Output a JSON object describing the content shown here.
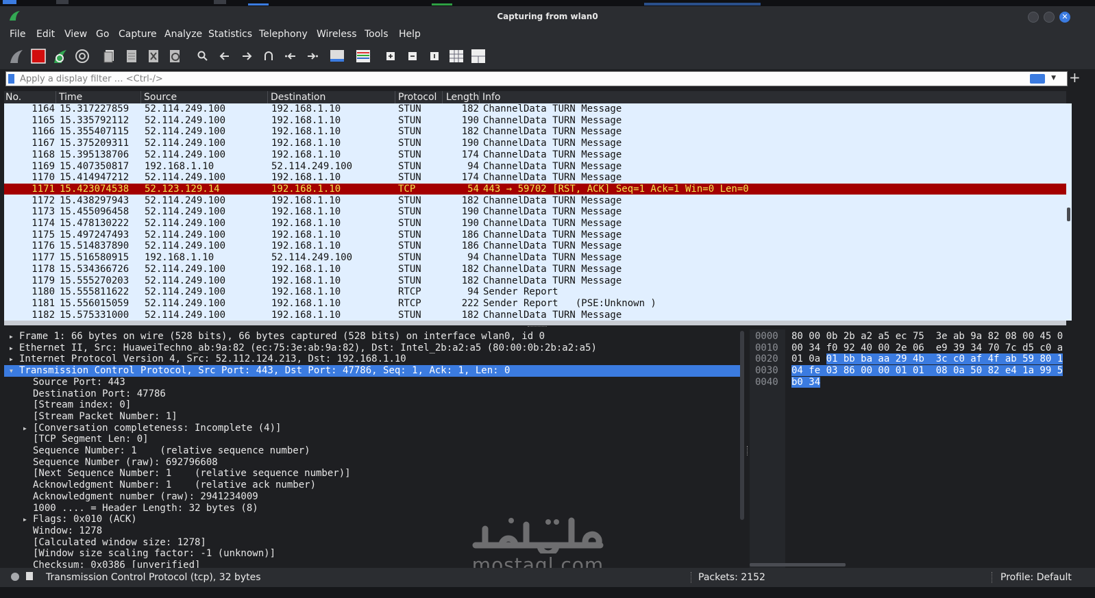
{
  "window": {
    "title": "Capturing from wlan0"
  },
  "menu": [
    "File",
    "Edit",
    "View",
    "Go",
    "Capture",
    "Analyze",
    "Statistics",
    "Telephony",
    "Wireless",
    "Tools",
    "Help"
  ],
  "filter": {
    "placeholder": "Apply a display filter … <Ctrl-/>"
  },
  "packet_list": {
    "columns": [
      "No.",
      "Time",
      "Source",
      "Destination",
      "Protocol",
      "Length",
      "Info"
    ],
    "rows": [
      {
        "no": "1164",
        "time": "15.317227859",
        "src": "52.114.249.100",
        "dst": "192.168.1.10",
        "proto": "STUN",
        "len": "182",
        "info": "ChannelData TURN Message"
      },
      {
        "no": "1165",
        "time": "15.335792112",
        "src": "52.114.249.100",
        "dst": "192.168.1.10",
        "proto": "STUN",
        "len": "190",
        "info": "ChannelData TURN Message"
      },
      {
        "no": "1166",
        "time": "15.355407115",
        "src": "52.114.249.100",
        "dst": "192.168.1.10",
        "proto": "STUN",
        "len": "182",
        "info": "ChannelData TURN Message"
      },
      {
        "no": "1167",
        "time": "15.375209311",
        "src": "52.114.249.100",
        "dst": "192.168.1.10",
        "proto": "STUN",
        "len": "190",
        "info": "ChannelData TURN Message"
      },
      {
        "no": "1168",
        "time": "15.395138706",
        "src": "52.114.249.100",
        "dst": "192.168.1.10",
        "proto": "STUN",
        "len": "174",
        "info": "ChannelData TURN Message"
      },
      {
        "no": "1169",
        "time": "15.407350817",
        "src": "192.168.1.10",
        "dst": "52.114.249.100",
        "proto": "STUN",
        "len": "94",
        "info": "ChannelData TURN Message"
      },
      {
        "no": "1170",
        "time": "15.414947212",
        "src": "52.114.249.100",
        "dst": "192.168.1.10",
        "proto": "STUN",
        "len": "174",
        "info": "ChannelData TURN Message"
      },
      {
        "no": "1171",
        "time": "15.423074538",
        "src": "52.123.129.14",
        "dst": "192.168.1.10",
        "proto": "TCP",
        "len": "54",
        "info": "443 → 59702 [RST, ACK] Seq=1 Ack=1 Win=0 Len=0"
      },
      {
        "no": "1172",
        "time": "15.438297943",
        "src": "52.114.249.100",
        "dst": "192.168.1.10",
        "proto": "STUN",
        "len": "182",
        "info": "ChannelData TURN Message"
      },
      {
        "no": "1173",
        "time": "15.455096458",
        "src": "52.114.249.100",
        "dst": "192.168.1.10",
        "proto": "STUN",
        "len": "190",
        "info": "ChannelData TURN Message"
      },
      {
        "no": "1174",
        "time": "15.478130222",
        "src": "52.114.249.100",
        "dst": "192.168.1.10",
        "proto": "STUN",
        "len": "190",
        "info": "ChannelData TURN Message"
      },
      {
        "no": "1175",
        "time": "15.497247493",
        "src": "52.114.249.100",
        "dst": "192.168.1.10",
        "proto": "STUN",
        "len": "186",
        "info": "ChannelData TURN Message"
      },
      {
        "no": "1176",
        "time": "15.514837890",
        "src": "52.114.249.100",
        "dst": "192.168.1.10",
        "proto": "STUN",
        "len": "186",
        "info": "ChannelData TURN Message"
      },
      {
        "no": "1177",
        "time": "15.516580915",
        "src": "192.168.1.10",
        "dst": "52.114.249.100",
        "proto": "STUN",
        "len": "94",
        "info": "ChannelData TURN Message"
      },
      {
        "no": "1178",
        "time": "15.534366726",
        "src": "52.114.249.100",
        "dst": "192.168.1.10",
        "proto": "STUN",
        "len": "182",
        "info": "ChannelData TURN Message"
      },
      {
        "no": "1179",
        "time": "15.555270203",
        "src": "52.114.249.100",
        "dst": "192.168.1.10",
        "proto": "STUN",
        "len": "182",
        "info": "ChannelData TURN Message"
      },
      {
        "no": "1180",
        "time": "15.555811622",
        "src": "52.114.249.100",
        "dst": "192.168.1.10",
        "proto": "RTCP",
        "len": "94",
        "info": "Sender Report"
      },
      {
        "no": "1181",
        "time": "15.556015059",
        "src": "52.114.249.100",
        "dst": "192.168.1.10",
        "proto": "RTCP",
        "len": "222",
        "info": "Sender Report   (PSE:Unknown )"
      },
      {
        "no": "1182",
        "time": "15.575331000",
        "src": "52.114.249.100",
        "dst": "192.168.1.10",
        "proto": "STUN",
        "len": "182",
        "info": "ChannelData TURN Message"
      }
    ],
    "selected_no": "1171"
  },
  "details": [
    {
      "text": "Frame 1: 66 bytes on wire (528 bits), 66 bytes captured (528 bits) on interface wlan0, id 0",
      "indent": 0,
      "toggle": "collapsed"
    },
    {
      "text": "Ethernet II, Src: HuaweiTechno_ab:9a:82 (ec:75:3e:ab:9a:82), Dst: Intel_2b:a2:a5 (80:00:0b:2b:a2:a5)",
      "indent": 0,
      "toggle": "collapsed"
    },
    {
      "text": "Internet Protocol Version 4, Src: 52.112.124.213, Dst: 192.168.1.10",
      "indent": 0,
      "toggle": "collapsed"
    },
    {
      "text": "Transmission Control Protocol, Src Port: 443, Dst Port: 47786, Seq: 1, Ack: 1, Len: 0",
      "indent": 0,
      "toggle": "expanded",
      "selected": true
    },
    {
      "text": "Source Port: 443",
      "indent": 1,
      "toggle": ""
    },
    {
      "text": "Destination Port: 47786",
      "indent": 1,
      "toggle": ""
    },
    {
      "text": "[Stream index: 0]",
      "indent": 1,
      "toggle": ""
    },
    {
      "text": "[Stream Packet Number: 1]",
      "indent": 1,
      "toggle": ""
    },
    {
      "text": "[Conversation completeness: Incomplete (4)]",
      "indent": 1,
      "toggle": "collapsed"
    },
    {
      "text": "[TCP Segment Len: 0]",
      "indent": 1,
      "toggle": ""
    },
    {
      "text": "Sequence Number: 1    (relative sequence number)",
      "indent": 1,
      "toggle": ""
    },
    {
      "text": "Sequence Number (raw): 692796608",
      "indent": 1,
      "toggle": ""
    },
    {
      "text": "[Next Sequence Number: 1    (relative sequence number)]",
      "indent": 1,
      "toggle": ""
    },
    {
      "text": "Acknowledgment Number: 1    (relative ack number)",
      "indent": 1,
      "toggle": ""
    },
    {
      "text": "Acknowledgment number (raw): 2941234009",
      "indent": 1,
      "toggle": ""
    },
    {
      "text": "1000 .... = Header Length: 32 bytes (8)",
      "indent": 1,
      "toggle": ""
    },
    {
      "text": "Flags: 0x010 (ACK)",
      "indent": 1,
      "toggle": "collapsed"
    },
    {
      "text": "Window: 1278",
      "indent": 1,
      "toggle": ""
    },
    {
      "text": "[Calculated window size: 1278]",
      "indent": 1,
      "toggle": ""
    },
    {
      "text": "[Window size scaling factor: -1 (unknown)]",
      "indent": 1,
      "toggle": ""
    },
    {
      "text": "Checksum: 0x0386 [unverified]",
      "indent": 1,
      "toggle": ""
    }
  ],
  "hex": [
    {
      "offset": "0000",
      "plain": "80 00 0b 2b a2 a5 ec 75  3e ab 9a 82 08 00 45 0",
      "hl": ""
    },
    {
      "offset": "0010",
      "plain": "00 34 f0 92 40 00 2e 06  e9 39 34 70 7c d5 c0 a",
      "hl": ""
    },
    {
      "offset": "0020",
      "plain": "01 0a ",
      "hl": "01 bb ba aa 29 4b  3c c0 af 4f ab 59 80 1"
    },
    {
      "offset": "0030",
      "plain": "",
      "hl": "04 fe 03 86 00 00 01 01  08 0a 50 82 e4 1a 99 5"
    },
    {
      "offset": "0040",
      "plain": "",
      "hl": "b0 34"
    }
  ],
  "status": {
    "left": "Transmission Control Protocol (tcp), 32 bytes",
    "packets": "Packets: 2152",
    "profile": "Profile: Default"
  },
  "watermark": {
    "brand": "mostaql.com",
    "arabic": "مستقل"
  },
  "colors": {
    "selected_row_bg": "#a40000",
    "selected_row_fg": "#f2e74f",
    "list_bg": "#e1efff",
    "accent": "#3b7be0"
  },
  "icons": [
    "shark-fin-start-icon",
    "stop-capture-icon",
    "restart-capture-icon",
    "capture-options-icon",
    "open-file-icon",
    "save-file-icon",
    "close-file-icon",
    "reload-file-icon",
    "find-packet-icon",
    "go-back-icon",
    "go-forward-icon",
    "go-to-packet-icon",
    "first-packet-icon",
    "last-packet-icon",
    "auto-scroll-icon",
    "colorize-icon",
    "zoom-in-icon",
    "zoom-out-icon",
    "normal-size-icon",
    "resize-columns-icon",
    "layout-icon"
  ]
}
